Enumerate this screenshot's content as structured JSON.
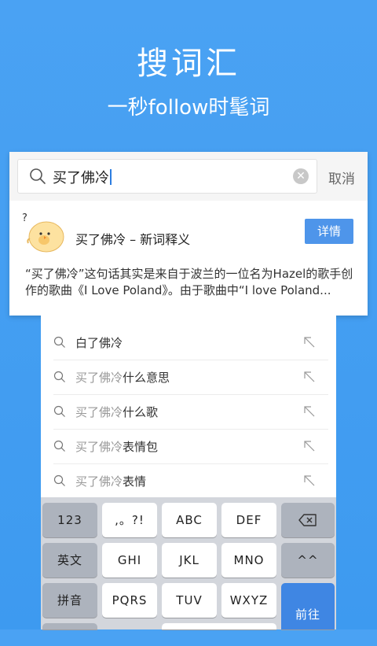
{
  "hero": {
    "title": "搜词汇",
    "subtitle": "一秒follow时髦词"
  },
  "search": {
    "query": "买了佛冷",
    "cancel_label": "取消"
  },
  "result": {
    "title": "买了佛冷 – 新词释义",
    "detail_label": "详情",
    "description": "“买了佛冷”这句话其实是来自于波兰的一位名为Hazel的歌手创作的歌曲《I Love Poland》。由于歌曲中“I love Poland..."
  },
  "suggestions": [
    {
      "prefix": "",
      "rest": "白了佛冷"
    },
    {
      "prefix": "买了佛冷",
      "rest": "什么意思"
    },
    {
      "prefix": "买了佛冷",
      "rest": "什么歌"
    },
    {
      "prefix": "买了佛冷",
      "rest": "表情包"
    },
    {
      "prefix": "买了佛冷",
      "rest": "表情"
    }
  ],
  "keyboard": {
    "k123": "123",
    "punct": ",。?!",
    "abc": "ABC",
    "def": "DEF",
    "english": "英文",
    "ghi": "GHI",
    "jkl": "JKL",
    "mno": "MNO",
    "face": "^^",
    "pinyin": "拼音",
    "pqrs": "PQRS",
    "tuv": "TUV",
    "wxyz": "WXYZ",
    "go": "前往"
  }
}
